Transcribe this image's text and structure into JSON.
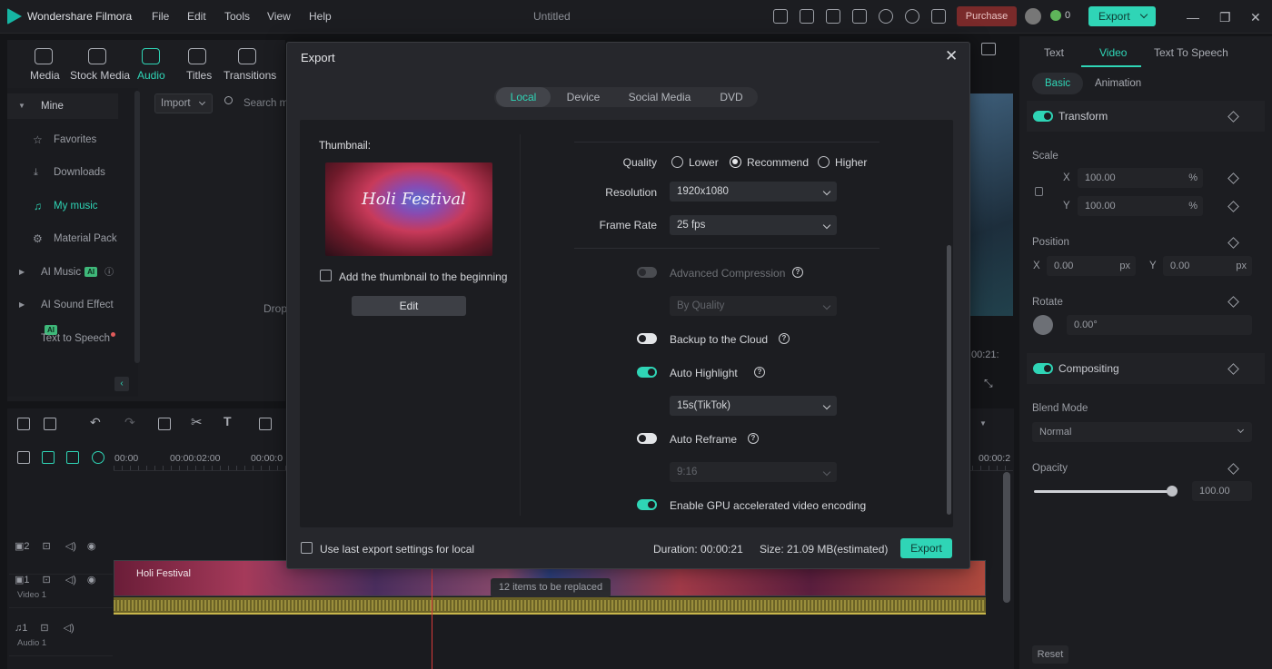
{
  "app": {
    "name": "Wondershare Filmora",
    "window_title": "Untitled"
  },
  "menu": [
    "File",
    "Edit",
    "Tools",
    "View",
    "Help"
  ],
  "topbar": {
    "purchase": "Purchase",
    "coins": "0",
    "export": "Export"
  },
  "media_tabs": [
    "Media",
    "Stock Media",
    "Audio",
    "Titles",
    "Transitions"
  ],
  "library": {
    "items": [
      {
        "label": "Mine",
        "icon": "caret-icon"
      },
      {
        "label": "Favorites",
        "icon": "star-icon"
      },
      {
        "label": "Downloads",
        "icon": "download-icon"
      },
      {
        "label": "My music",
        "icon": "music-icon"
      },
      {
        "label": "Material Pack",
        "icon": "gear-icon"
      },
      {
        "label": "AI Music",
        "icon": "caret-icon",
        "badge": "AI"
      },
      {
        "label": "AI Sound Effect",
        "icon": "caret-icon",
        "badge": "AI"
      },
      {
        "label": "Text to Speech",
        "icon": ""
      }
    ],
    "import": "Import",
    "search_placeholder": "Search m",
    "drop_text": "Drop"
  },
  "preview": {
    "time": "00:21:"
  },
  "properties": {
    "tabs": [
      "Text",
      "Video",
      "Text To Speech"
    ],
    "subtabs": [
      "Basic",
      "Animation"
    ],
    "transform": "Transform",
    "scale": "Scale",
    "scale_x": "100.00",
    "scale_y": "100.00",
    "axis_x": "X",
    "axis_y": "Y",
    "unit_pct": "%",
    "unit_px": "px",
    "position": "Position",
    "pos_x": "0.00",
    "pos_y": "0.00",
    "rotate": "Rotate",
    "rotate_val": "0.00°",
    "compositing": "Compositing",
    "blend_mode": "Blend Mode",
    "blend_val": "Normal",
    "opacity": "Opacity",
    "opacity_val": "100.00",
    "reset": "Reset"
  },
  "timeline": {
    "ruler": [
      "00:00",
      "00:00:02:00",
      "00:00:0",
      "00:00:2"
    ],
    "tracks": [
      {
        "num": "2",
        "sub": ""
      },
      {
        "num": "1",
        "sub": "Video 1"
      },
      {
        "num": "1",
        "sub": "Audio 1"
      }
    ],
    "clip_label": "Holi Festival",
    "replaced": "12 items to be replaced"
  },
  "export_dialog": {
    "title": "Export",
    "tabs": [
      "Local",
      "Device",
      "Social Media",
      "DVD"
    ],
    "thumbnail": {
      "title": "Thumbnail:",
      "image_text": "Holi Festival",
      "checkbox": "Add the thumbnail to the beginning",
      "edit": "Edit"
    },
    "quality": {
      "label": "Quality",
      "options": [
        "Lower",
        "Recommend",
        "Higher"
      ],
      "selected": "Recommend"
    },
    "resolution": {
      "label": "Resolution",
      "value": "1920x1080"
    },
    "frame_rate": {
      "label": "Frame Rate",
      "value": "25 fps"
    },
    "advanced_compression": {
      "label": "Advanced Compression",
      "on": false,
      "disabled": true,
      "select": "By Quality"
    },
    "backup_cloud": {
      "label": "Backup to the Cloud",
      "on": false
    },
    "auto_highlight": {
      "label": "Auto Highlight",
      "on": true,
      "select": "15s(TikTok)"
    },
    "auto_reframe": {
      "label": "Auto Reframe",
      "on": false,
      "select": "9:16"
    },
    "gpu": {
      "label": "Enable GPU accelerated video encoding",
      "on": true
    },
    "footer": {
      "use_last": "Use last export settings for local",
      "duration": "Duration: 00:00:21",
      "size": "Size: 21.09 MB(estimated)",
      "export": "Export"
    }
  },
  "colors": {
    "accent": "#2fd5b6",
    "purchase": "#7a2a2a",
    "background": "#141518"
  }
}
